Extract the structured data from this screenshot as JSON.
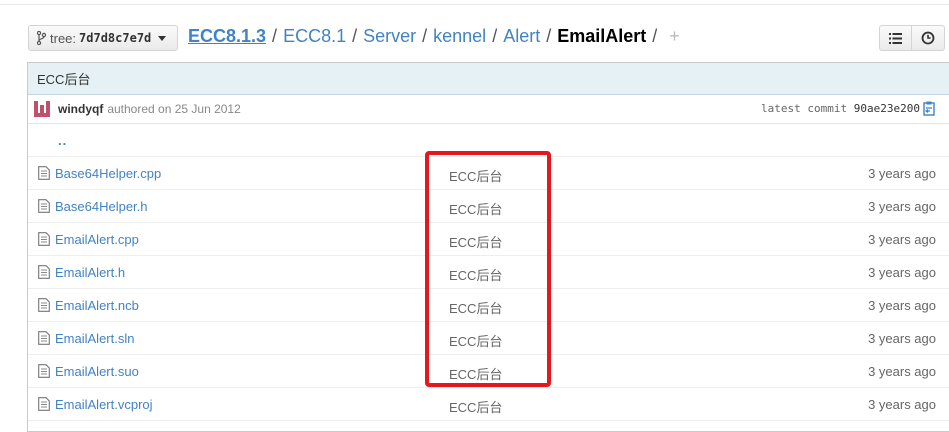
{
  "branch": {
    "prefix": "tree:",
    "sha": "7d7d8c7e7d"
  },
  "breadcrumb": {
    "root": "ECC8.1.3",
    "parts": [
      "ECC8.1",
      "Server",
      "kennel",
      "Alert"
    ],
    "current": "EmailAlert",
    "separator": "/",
    "plus": "+"
  },
  "view_buttons": {
    "list_icon": "list-icon",
    "history_icon": "history-clock-icon"
  },
  "commit": {
    "message": "ECC后台",
    "author": "windyqf",
    "authored_text": "authored on 25 Jun 2012",
    "latest_label": "latest commit",
    "sha": "90ae23e200",
    "copy_icon": "clipboard-copy-icon"
  },
  "parent_link": "..",
  "files": [
    {
      "name": "Base64Helper.cpp",
      "message": "ECC后台",
      "age": "3 years ago"
    },
    {
      "name": "Base64Helper.h",
      "message": "ECC后台",
      "age": "3 years ago"
    },
    {
      "name": "EmailAlert.cpp",
      "message": "ECC后台",
      "age": "3 years ago"
    },
    {
      "name": "EmailAlert.h",
      "message": "ECC后台",
      "age": "3 years ago"
    },
    {
      "name": "EmailAlert.ncb",
      "message": "ECC后台",
      "age": "3 years ago"
    },
    {
      "name": "EmailAlert.sln",
      "message": "ECC后台",
      "age": "3 years ago"
    },
    {
      "name": "EmailAlert.suo",
      "message": "ECC后台",
      "age": "3 years ago"
    },
    {
      "name": "EmailAlert.vcproj",
      "message": "ECC后台",
      "age": "3 years ago"
    }
  ],
  "colors": {
    "link": "#4183c4",
    "commit_bar": "#e6f1f6",
    "highlight": "#e3191e"
  }
}
